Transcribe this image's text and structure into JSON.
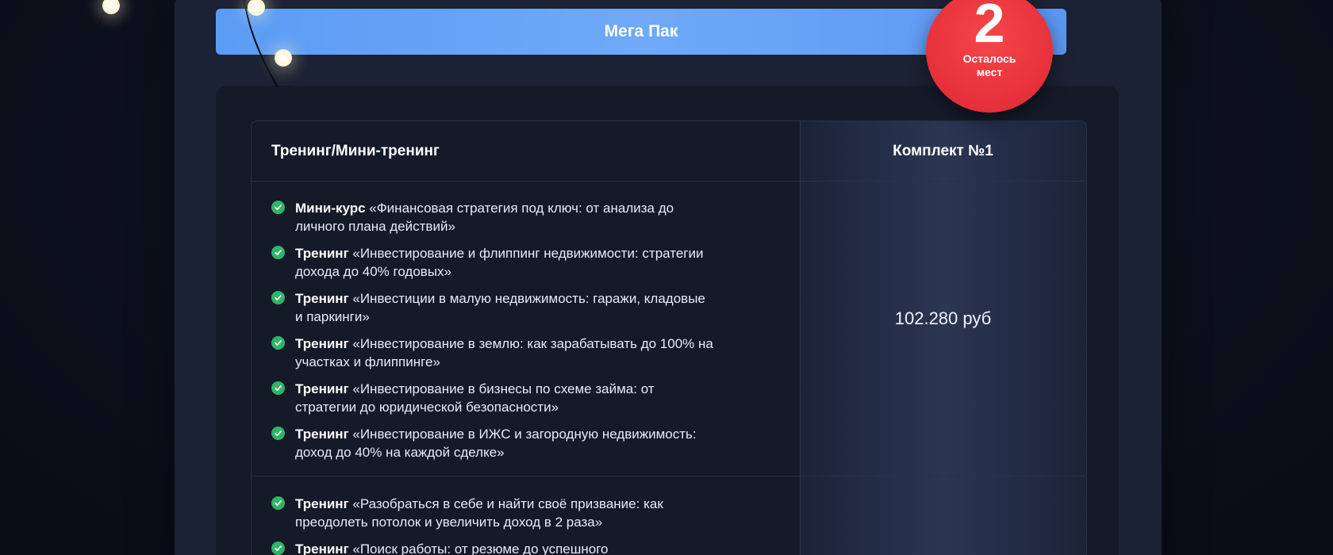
{
  "pack_button": {
    "label": "Мега Пак"
  },
  "badge": {
    "count": "2",
    "caption_line1": "Осталось",
    "caption_line2": "мест"
  },
  "table": {
    "headers": {
      "left": "Тренинг/Мини-тренинг",
      "right": "Комплект №1"
    },
    "group1": {
      "price": "102.280 руб",
      "items": [
        {
          "bold": "Мини-курс",
          "text": " «Финансовая стратегия под ключ: от анализа до личного плана действий»"
        },
        {
          "bold": "Тренинг",
          "text": " «Инвестирование и флиппинг недвижимости: стратегии дохода до 40% годовых»"
        },
        {
          "bold": "Тренинг",
          "text": " «Инвестиции в малую недвижимость: гаражи, кладовые и паркинги»"
        },
        {
          "bold": "Тренинг",
          "text": " «Инвестирование в землю: как зарабатывать до 100% на участках и флиппинге»"
        },
        {
          "bold": "Тренинг",
          "text": " «Инвестирование в бизнесы по схеме займа: от стратегии до юридической безопасности»"
        },
        {
          "bold": "Тренинг",
          "text": " «Инвестирование в ИЖС и загородную недвижимость: доход до 40% на каждой сделке»"
        }
      ]
    },
    "group2": {
      "items": [
        {
          "bold": "Тренинг",
          "text": " «Разобраться в себе и найти своё призвание: как преодолеть потолок и увеличить доход в 2 раза»"
        },
        {
          "bold": "Тренинг",
          "text": " «Поиск работы: от резюме до успешного"
        }
      ]
    }
  },
  "colors": {
    "accent_blue": "#5b9cf5",
    "badge_red": "#e6303a",
    "check_green": "#2fb566",
    "background": "#0b101c"
  }
}
